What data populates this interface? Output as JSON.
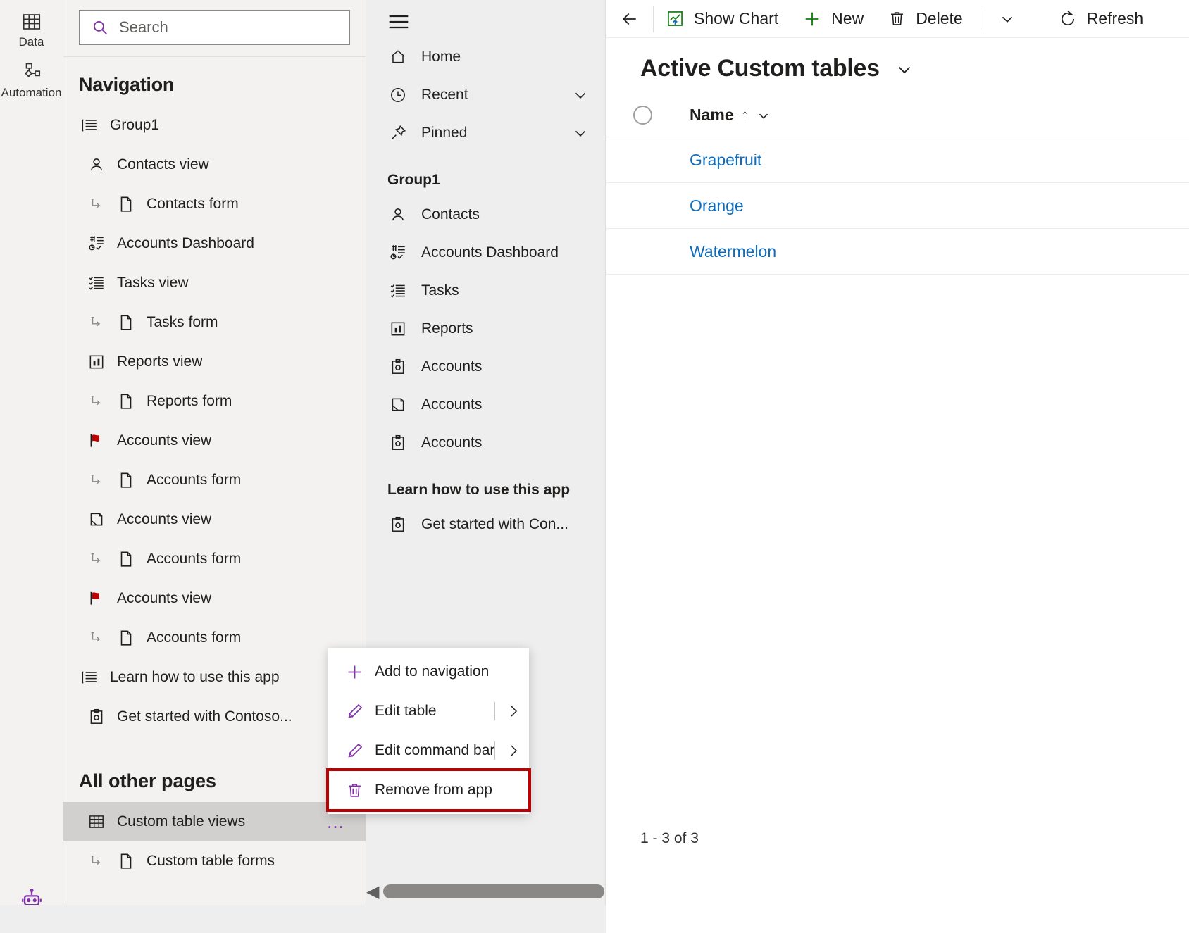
{
  "rail": {
    "items": [
      {
        "label": "Data",
        "icon": "table-icon"
      },
      {
        "label": "Automation",
        "icon": "flow-icon"
      }
    ],
    "bottom_icon": "copilot-robot-icon"
  },
  "search": {
    "placeholder": "Search",
    "value": "",
    "icon": "search-icon"
  },
  "navigation": {
    "title": "Navigation",
    "tree": [
      {
        "label": "Group1",
        "icon": "group-list-icon",
        "level": 0
      },
      {
        "label": "Contacts view",
        "icon": "contact-icon",
        "level": 1
      },
      {
        "label": "Contacts form",
        "icon": "form-page-icon",
        "level": 2
      },
      {
        "label": "Accounts Dashboard",
        "icon": "dashboard-icon",
        "level": 1
      },
      {
        "label": "Tasks view",
        "icon": "task-list-icon",
        "level": 1
      },
      {
        "label": "Tasks form",
        "icon": "form-page-icon",
        "level": 2
      },
      {
        "label": "Reports view",
        "icon": "report-chart-icon",
        "level": 1
      },
      {
        "label": "Reports form",
        "icon": "form-page-icon",
        "level": 2
      },
      {
        "label": "Accounts view",
        "icon": "red-flag-icon",
        "level": 1
      },
      {
        "label": "Accounts form",
        "icon": "form-page-icon",
        "level": 2
      },
      {
        "label": "Accounts view",
        "icon": "case-folder-icon",
        "level": 1
      },
      {
        "label": "Accounts form",
        "icon": "form-page-icon",
        "level": 2
      },
      {
        "label": "Accounts view",
        "icon": "red-flag-icon",
        "level": 1
      },
      {
        "label": "Accounts form",
        "icon": "form-page-icon",
        "level": 2
      },
      {
        "label": "Learn how to use this app",
        "icon": "group-list-icon",
        "level": 0
      },
      {
        "label": "Get started with Contoso...",
        "icon": "clipboard-gear-icon",
        "level": 1
      }
    ],
    "all_other_pages_heading": "All other pages",
    "other_pages": [
      {
        "label": "Custom table views",
        "icon": "table-grid-icon",
        "level": 1,
        "selected": true,
        "overflow": "…"
      },
      {
        "label": "Custom table forms",
        "icon": "form-page-icon",
        "level": 2,
        "selected": false
      }
    ]
  },
  "context_menu": {
    "items": [
      {
        "label": "Add to navigation",
        "icon": "plus-icon",
        "submenu": false,
        "highlighted": false
      },
      {
        "label": "Edit table",
        "icon": "pencil-icon",
        "submenu": true,
        "highlighted": false
      },
      {
        "label": "Edit command bar",
        "icon": "pencil-icon",
        "submenu": true,
        "highlighted": false
      },
      {
        "label": "Remove from app",
        "icon": "trash-icon",
        "submenu": false,
        "highlighted": true
      }
    ],
    "highlight_color": "#c00000",
    "icon_color": "#8031a7"
  },
  "sitemap": {
    "menu_icon": "hamburger-icon",
    "top_items": [
      {
        "label": "Home",
        "icon": "home-icon",
        "chevron": false
      },
      {
        "label": "Recent",
        "icon": "clock-icon",
        "chevron": true
      },
      {
        "label": "Pinned",
        "icon": "pin-icon",
        "chevron": true
      }
    ],
    "group1_heading": "Group1",
    "group1_items": [
      {
        "label": "Contacts",
        "icon": "contact-icon"
      },
      {
        "label": "Accounts Dashboard",
        "icon": "dashboard-icon"
      },
      {
        "label": "Tasks",
        "icon": "task-list-icon"
      },
      {
        "label": "Reports",
        "icon": "report-chart-icon"
      },
      {
        "label": "Accounts",
        "icon": "clipboard-gear-icon"
      },
      {
        "label": "Accounts",
        "icon": "case-folder-icon"
      },
      {
        "label": "Accounts",
        "icon": "clipboard-gear-icon"
      }
    ],
    "learn_heading": "Learn how to use this app",
    "learn_items": [
      {
        "label": "Get started with Con...",
        "icon": "clipboard-gear-icon"
      }
    ]
  },
  "commandbar": {
    "back_icon": "back-arrow-icon",
    "buttons": [
      {
        "label": "Show Chart",
        "icon": "show-chart-icon"
      },
      {
        "label": "New",
        "icon": "plus-icon"
      },
      {
        "label": "Delete",
        "icon": "trash-icon"
      }
    ],
    "overflow_caret": "chevron-down-icon",
    "refresh": {
      "label": "Refresh",
      "icon": "refresh-icon"
    }
  },
  "grid": {
    "view_name": "Active Custom tables",
    "view_caret": "chevron-down-icon",
    "column_header": "Name",
    "sort_indicator": "↑",
    "column_caret": "⌄",
    "rows": [
      {
        "name": "Grapefruit"
      },
      {
        "name": "Orange"
      },
      {
        "name": "Watermelon"
      }
    ],
    "record_count": "1 - 3 of 3",
    "link_color": "#0f6cbd"
  },
  "scrollbar": {
    "left_arrow": "◀",
    "right_arrow": "▶"
  }
}
